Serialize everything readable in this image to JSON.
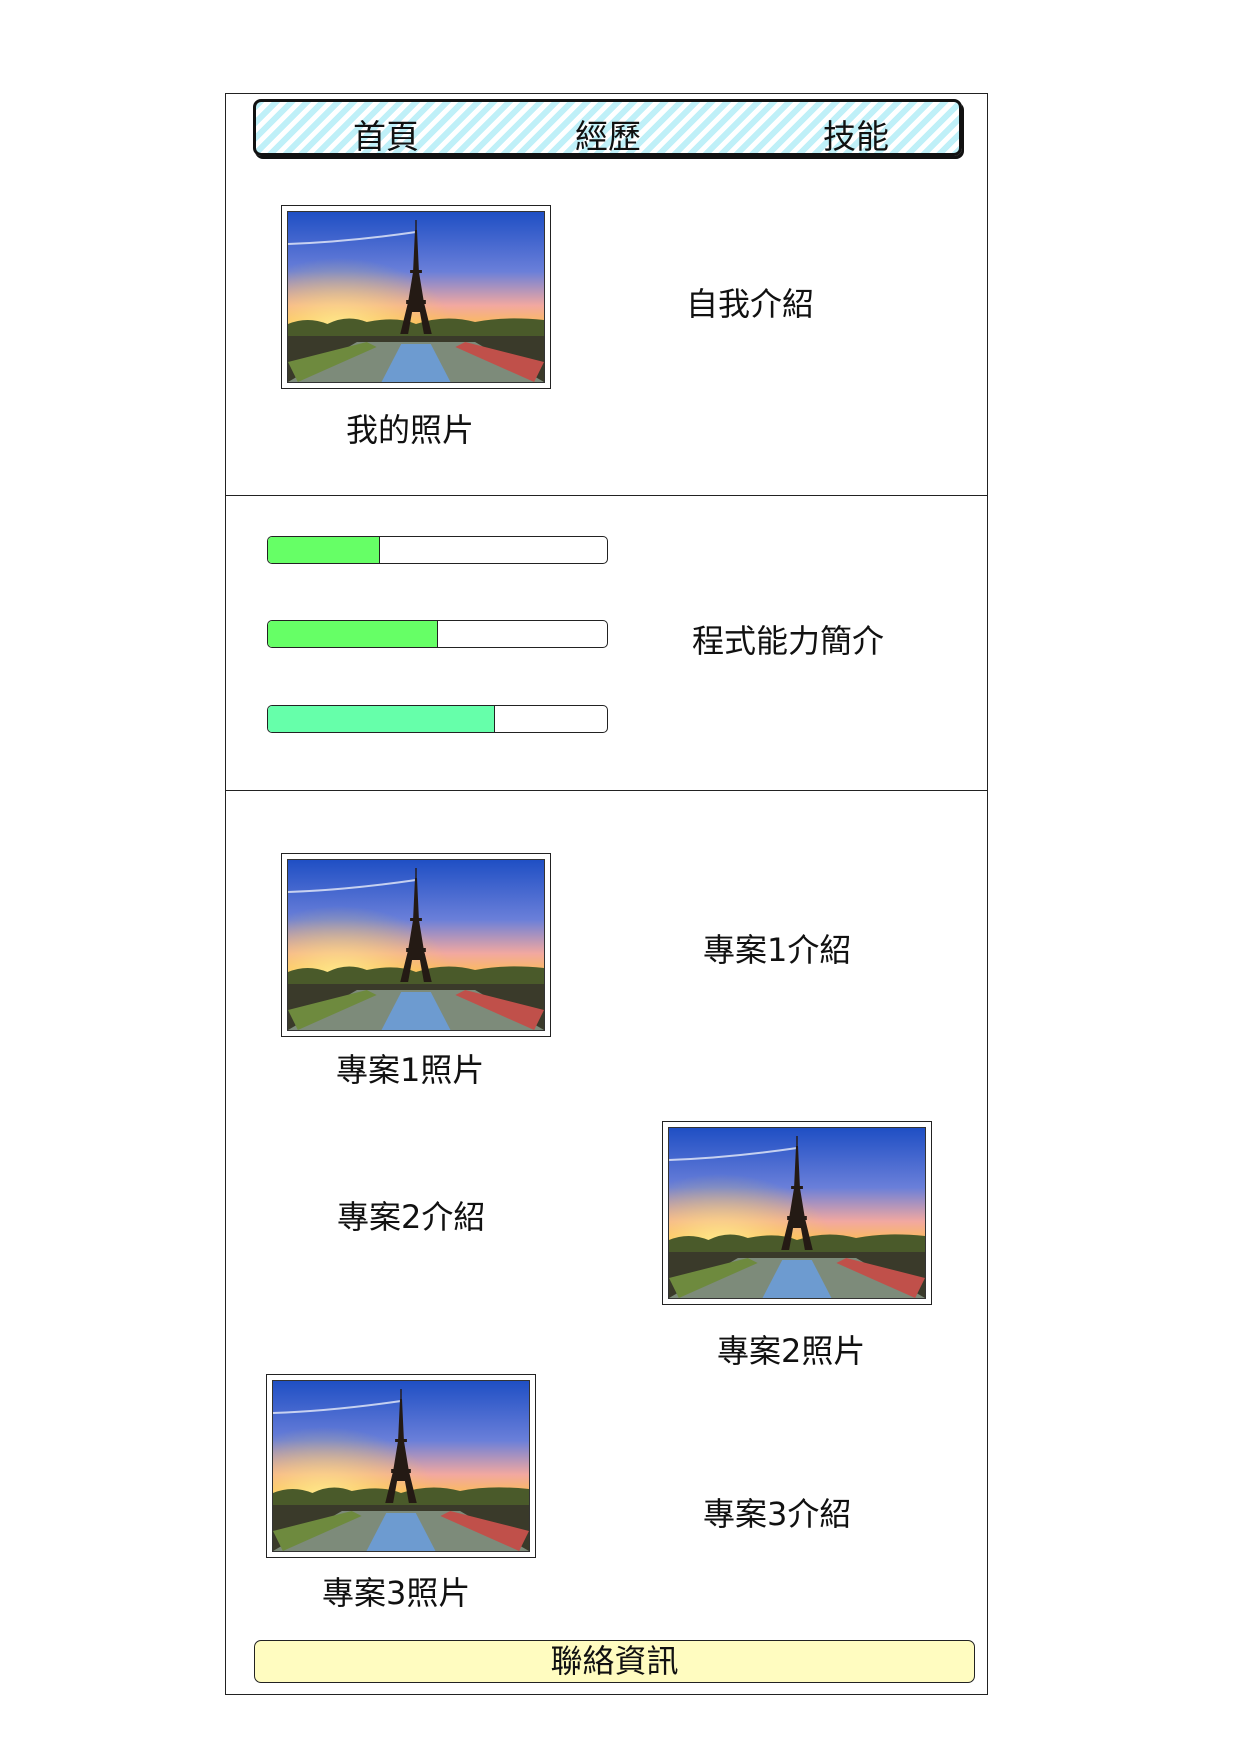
{
  "nav": {
    "items": [
      {
        "label": "首頁"
      },
      {
        "label": "經歷"
      },
      {
        "label": "技能"
      }
    ]
  },
  "profile": {
    "photo_caption": "我的照片",
    "intro": "自我介紹"
  },
  "skills": {
    "title": "程式能力簡介",
    "bars": [
      {
        "fraction": 0.33,
        "color": "#66ff66"
      },
      {
        "fraction": 0.5,
        "color": "#66ff66"
      },
      {
        "fraction": 0.67,
        "color": "#66ffaa"
      }
    ]
  },
  "projects": [
    {
      "photo_caption": "專案1照片",
      "intro": "專案1介紹"
    },
    {
      "photo_caption": "專案2照片",
      "intro": "專案2介紹"
    },
    {
      "photo_caption": "專案3照片",
      "intro": "專案3介紹"
    }
  ],
  "footer": {
    "label": "聯絡資訊"
  },
  "photo_icon": "eiffel-tower-sunset"
}
